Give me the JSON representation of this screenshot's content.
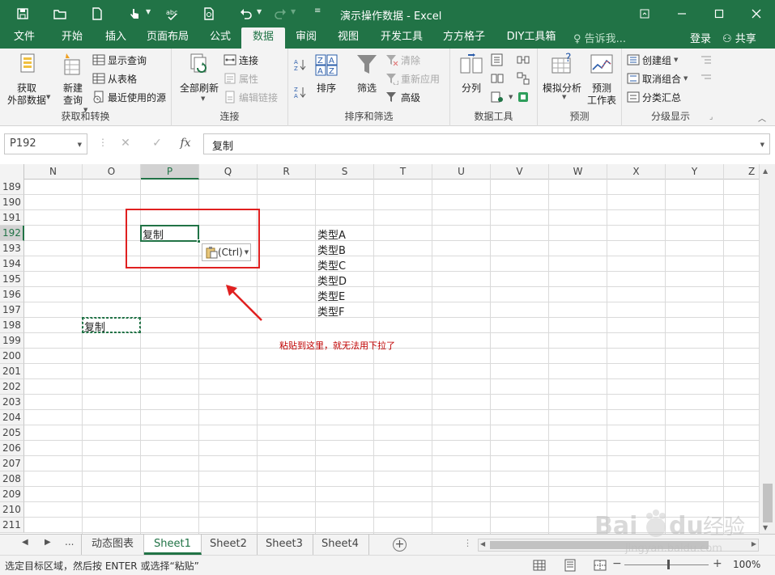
{
  "window": {
    "title": "演示操作数据 - Excel"
  },
  "tabs": [
    "文件",
    "开始",
    "插入",
    "页面布局",
    "公式",
    "数据",
    "审阅",
    "视图",
    "开发工具",
    "方方格子",
    "DIY工具箱"
  ],
  "tell_me": "告诉我...",
  "login": "登录",
  "share": "共享",
  "ribbon": {
    "get_external": "获取\n外部数据",
    "new_query": "新建\n查询",
    "show_queries": "显示查询",
    "from_table": "从表格",
    "recent_sources": "最近使用的源",
    "group_get_transform": "获取和转换",
    "refresh_all": "全部刷新",
    "connections": "连接",
    "properties": "属性",
    "edit_links": "编辑链接",
    "group_connections": "连接",
    "sort": "排序",
    "filter": "筛选",
    "clear": "清除",
    "reapply": "重新应用",
    "advanced": "高级",
    "group_sort_filter": "排序和筛选",
    "text_to_columns": "分列",
    "group_data_tools": "数据工具",
    "what_if": "模拟分析",
    "forecast_sheet": "预测\n工作表",
    "group_forecast": "预测",
    "group": "创建组",
    "ungroup": "取消组合",
    "subtotal": "分类汇总",
    "group_outline": "分级显示"
  },
  "formula_bar": {
    "name_box": "P192",
    "fx": "fx",
    "content": "复制"
  },
  "grid": {
    "columns": [
      "N",
      "O",
      "P",
      "Q",
      "R",
      "S",
      "T",
      "U",
      "V",
      "W",
      "X",
      "Y",
      "Z"
    ],
    "selected_column": "P",
    "rows": [
      "189",
      "190",
      "191",
      "192",
      "193",
      "194",
      "195",
      "196",
      "197",
      "198",
      "199",
      "200",
      "201",
      "202",
      "203",
      "204",
      "205",
      "206",
      "207",
      "208",
      "209",
      "210",
      "211"
    ],
    "selected_row": "192",
    "cells": {
      "p192": "复制",
      "o198": "复制",
      "s192": "类型A",
      "s193": "类型B",
      "s194": "类型C",
      "s195": "类型D",
      "s196": "类型E",
      "s197": "类型F"
    },
    "paste_options": "(Ctrl)",
    "annotation": "粘贴到这里，就无法用下拉了"
  },
  "sheets": {
    "more": "...",
    "tabs": [
      "动态图表",
      "Sheet1",
      "Sheet2",
      "Sheet3",
      "Sheet4"
    ],
    "active": "Sheet1"
  },
  "status": {
    "message": "选定目标区域，然后按 ENTER 或选择“粘贴”",
    "zoom": "100%"
  },
  "colors": {
    "excel_green": "#217346",
    "annotation_red": "#e02020"
  }
}
